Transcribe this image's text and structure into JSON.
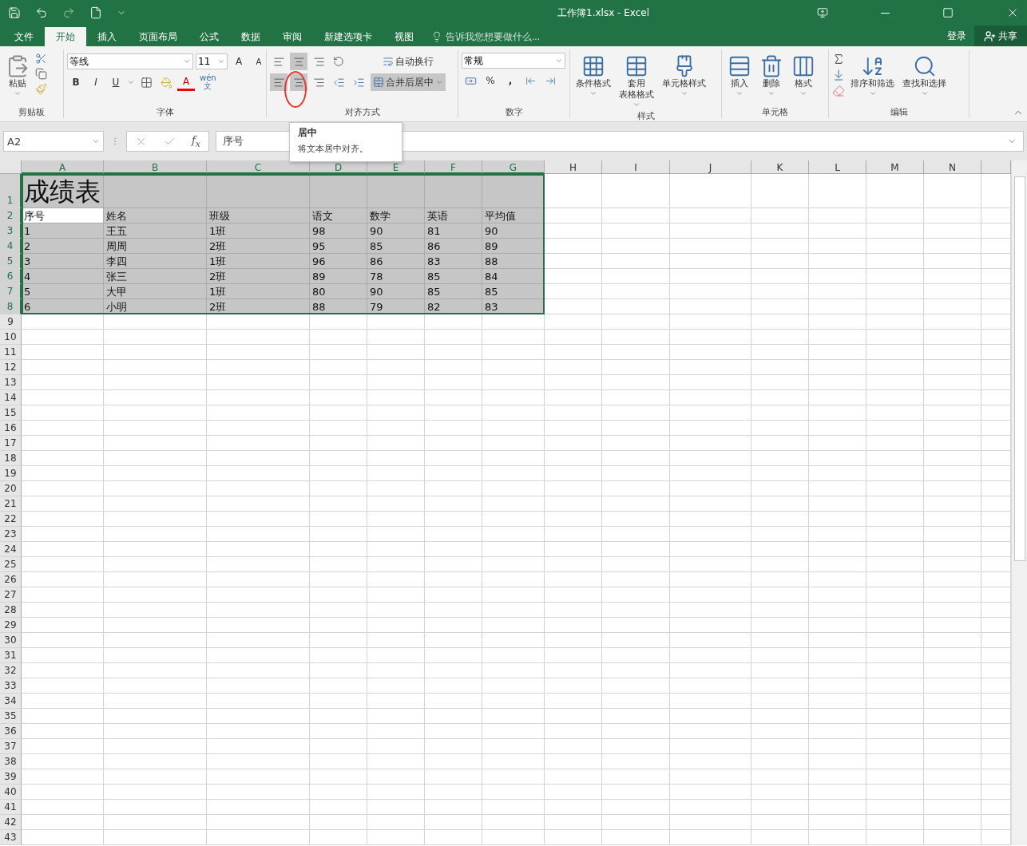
{
  "title_bar": {
    "title": "工作簿1.xlsx - Excel"
  },
  "tabs": [
    {
      "label": "文件",
      "selected": false
    },
    {
      "label": "开始",
      "selected": true
    },
    {
      "label": "插入",
      "selected": false
    },
    {
      "label": "页面布局",
      "selected": false
    },
    {
      "label": "公式",
      "selected": false
    },
    {
      "label": "数据",
      "selected": false
    },
    {
      "label": "审阅",
      "selected": false
    },
    {
      "label": "新建选项卡",
      "selected": false
    },
    {
      "label": "视图",
      "selected": false
    }
  ],
  "tell_me": {
    "placeholder": "告诉我您想要做什么..."
  },
  "account": {
    "sign_in": "登录",
    "share": "共享"
  },
  "clipboard": {
    "paste": "粘贴",
    "label": "剪贴板"
  },
  "font": {
    "name": "等线",
    "size": "11",
    "grow": "A",
    "shrink": "A",
    "bold": "B",
    "italic": "I",
    "underline": "U",
    "font_color_letter": "A",
    "phonetic_top": "wén",
    "phonetic_bottom": "文",
    "label": "字体"
  },
  "alignment": {
    "vertical": [
      {
        "kind": "top",
        "selected": false
      },
      {
        "kind": "middle",
        "selected": true
      },
      {
        "kind": "bottom",
        "selected": false
      }
    ],
    "horizontal": [
      {
        "kind": "left",
        "selected": true
      },
      {
        "kind": "center",
        "selected": true
      },
      {
        "kind": "right",
        "selected": false
      }
    ],
    "wrap": "自动换行",
    "merge": "合并后居中",
    "label": "对齐方式"
  },
  "number": {
    "format": "常规",
    "percent": "%",
    "comma": ",",
    "label": "数字"
  },
  "styles": {
    "buttons": [
      {
        "kind": "conditional",
        "lines": [
          "条件格式"
        ]
      },
      {
        "kind": "table",
        "lines": [
          "套用",
          "表格格式"
        ]
      },
      {
        "kind": "cellstyle",
        "lines": [
          "单元格样式"
        ]
      }
    ],
    "label": "样式"
  },
  "cells": {
    "buttons": [
      {
        "kind": "insert",
        "lines": [
          "插入"
        ]
      },
      {
        "kind": "delete",
        "lines": [
          "删除"
        ]
      },
      {
        "kind": "format",
        "lines": [
          "格式"
        ]
      }
    ],
    "label": "单元格"
  },
  "editing": {
    "buttons": [
      {
        "kind": "sort",
        "lines": [
          "排序和筛选"
        ]
      },
      {
        "kind": "find",
        "lines": [
          "查找和选择"
        ]
      }
    ],
    "label": "编辑"
  },
  "formula_bar": {
    "name_box": "A2",
    "function_label": "f$_{x}$",
    "value": "序号"
  },
  "tooltip": {
    "title": "居中",
    "text": "将文本居中对齐。"
  },
  "columns": [
    {
      "label": "A",
      "selected": true
    },
    {
      "label": "B",
      "selected": true
    },
    {
      "label": "C",
      "selected": true
    },
    {
      "label": "D",
      "selected": true
    },
    {
      "label": "E",
      "selected": true
    },
    {
      "label": "F",
      "selected": true
    },
    {
      "label": "G",
      "selected": true
    },
    {
      "label": "H",
      "selected": false
    },
    {
      "label": "I",
      "selected": false
    },
    {
      "label": "J",
      "selected": false
    },
    {
      "label": "K",
      "selected": false
    },
    {
      "label": "L",
      "selected": false
    },
    {
      "label": "M",
      "selected": false
    },
    {
      "label": "N",
      "selected": false
    }
  ],
  "rows": [
    {
      "number": "1",
      "selected": true,
      "cells": [
        {
          "text": "成绩表",
          "active": false
        }
      ]
    },
    {
      "number": "2",
      "selected": true,
      "cells": [
        {
          "text": "序号",
          "active": true
        },
        {
          "text": "姓名",
          "active": false
        },
        {
          "text": "班级",
          "active": false
        },
        {
          "text": "语文",
          "active": false
        },
        {
          "text": "数学",
          "active": false
        },
        {
          "text": "英语",
          "active": false
        },
        {
          "text": "平均值",
          "active": false
        }
      ]
    },
    {
      "number": "3",
      "selected": true,
      "cells": [
        {
          "text": "1",
          "active": false
        },
        {
          "text": "王五",
          "active": false
        },
        {
          "text": "1班",
          "active": false
        },
        {
          "text": "98",
          "active": false
        },
        {
          "text": "90",
          "active": false
        },
        {
          "text": "81",
          "active": false
        },
        {
          "text": "90",
          "active": false
        }
      ]
    },
    {
      "number": "4",
      "selected": true,
      "cells": [
        {
          "text": "2",
          "active": false
        },
        {
          "text": "周周",
          "active": false
        },
        {
          "text": "2班",
          "active": false
        },
        {
          "text": "95",
          "active": false
        },
        {
          "text": "85",
          "active": false
        },
        {
          "text": "86",
          "active": false
        },
        {
          "text": "89",
          "active": false
        }
      ]
    },
    {
      "number": "5",
      "selected": true,
      "cells": [
        {
          "text": "3",
          "active": false
        },
        {
          "text": "李四",
          "active": false
        },
        {
          "text": "1班",
          "active": false
        },
        {
          "text": "96",
          "active": false
        },
        {
          "text": "86",
          "active": false
        },
        {
          "text": "83",
          "active": false
        },
        {
          "text": "88",
          "active": false
        }
      ]
    },
    {
      "number": "6",
      "selected": true,
      "cells": [
        {
          "text": "4",
          "active": false
        },
        {
          "text": "张三",
          "active": false
        },
        {
          "text": "2班",
          "active": false
        },
        {
          "text": "89",
          "active": false
        },
        {
          "text": "78",
          "active": false
        },
        {
          "text": "85",
          "active": false
        },
        {
          "text": "84",
          "active": false
        }
      ]
    },
    {
      "number": "7",
      "selected": true,
      "cells": [
        {
          "text": "5",
          "active": false
        },
        {
          "text": "大甲",
          "active": false
        },
        {
          "text": "1班",
          "active": false
        },
        {
          "text": "80",
          "active": false
        },
        {
          "text": "90",
          "active": false
        },
        {
          "text": "85",
          "active": false
        },
        {
          "text": "85",
          "active": false
        }
      ]
    },
    {
      "number": "8",
      "selected": true,
      "cells": [
        {
          "text": "6",
          "active": false
        },
        {
          "text": "小明",
          "active": false
        },
        {
          "text": "2班",
          "active": false
        },
        {
          "text": "88",
          "active": false
        },
        {
          "text": "79",
          "active": false
        },
        {
          "text": "82",
          "active": false
        },
        {
          "text": "83",
          "active": false
        }
      ]
    },
    {
      "number": "9",
      "selected": false,
      "cells": []
    },
    {
      "number": "10",
      "selected": false,
      "cells": []
    },
    {
      "number": "11",
      "selected": false,
      "cells": []
    },
    {
      "number": "12",
      "selected": false,
      "cells": []
    },
    {
      "number": "13",
      "selected": false,
      "cells": []
    },
    {
      "number": "14",
      "selected": false,
      "cells": []
    },
    {
      "number": "15",
      "selected": false,
      "cells": []
    },
    {
      "number": "16",
      "selected": false,
      "cells": []
    },
    {
      "number": "17",
      "selected": false,
      "cells": []
    },
    {
      "number": "18",
      "selected": false,
      "cells": []
    },
    {
      "number": "19",
      "selected": false,
      "cells": []
    },
    {
      "number": "20",
      "selected": false,
      "cells": []
    },
    {
      "number": "21",
      "selected": false,
      "cells": []
    },
    {
      "number": "22",
      "selected": false,
      "cells": []
    },
    {
      "number": "23",
      "selected": false,
      "cells": []
    },
    {
      "number": "24",
      "selected": false,
      "cells": []
    },
    {
      "number": "25",
      "selected": false,
      "cells": []
    },
    {
      "number": "26",
      "selected": false,
      "cells": []
    },
    {
      "number": "27",
      "selected": false,
      "cells": []
    },
    {
      "number": "28",
      "selected": false,
      "cells": []
    },
    {
      "number": "29",
      "selected": false,
      "cells": []
    },
    {
      "number": "30",
      "selected": false,
      "cells": []
    },
    {
      "number": "31",
      "selected": false,
      "cells": []
    },
    {
      "number": "32",
      "selected": false,
      "cells": []
    },
    {
      "number": "33",
      "selected": false,
      "cells": []
    },
    {
      "number": "34",
      "selected": false,
      "cells": []
    },
    {
      "number": "35",
      "selected": false,
      "cells": []
    },
    {
      "number": "36",
      "selected": false,
      "cells": []
    },
    {
      "number": "37",
      "selected": false,
      "cells": []
    },
    {
      "number": "38",
      "selected": false,
      "cells": []
    },
    {
      "number": "39",
      "selected": false,
      "cells": []
    },
    {
      "number": "40",
      "selected": false,
      "cells": []
    },
    {
      "number": "41",
      "selected": false,
      "cells": []
    },
    {
      "number": "42",
      "selected": false,
      "cells": []
    },
    {
      "number": "43",
      "selected": false,
      "cells": []
    }
  ]
}
